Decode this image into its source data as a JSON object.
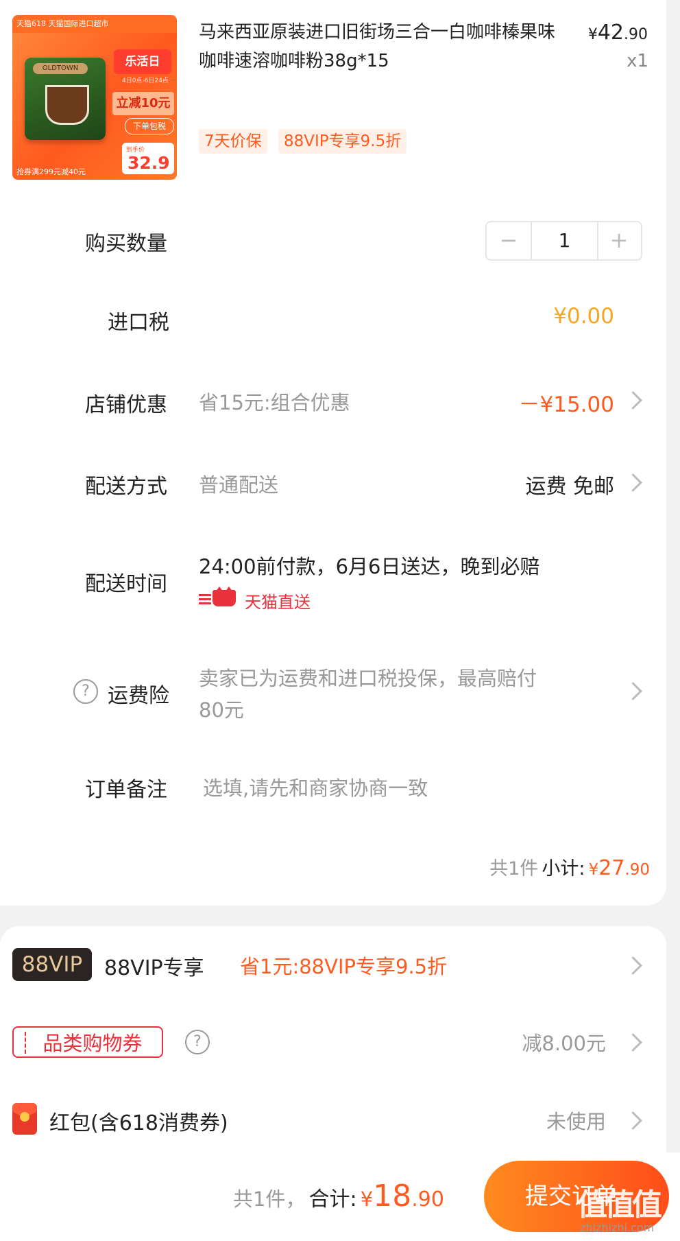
{
  "product": {
    "image": {
      "top_strip": "天猫618 天猫国际进口超市",
      "brand": "OLDTOWN",
      "promo_badge": "乐活日",
      "promo_sub": "4日0点-6日24点",
      "discount": "立减10元",
      "tax_included": "下单包税",
      "final_label": "到手价",
      "final_price": "32.9",
      "bottom_text": "抢券满299元减40元"
    },
    "title": "马来西亚原装进口旧街场三合一白咖啡榛果味咖啡速溶咖啡粉38g*15",
    "price_symbol": "¥",
    "price_int": "42",
    "price_dec": ".90",
    "qty_label": "x1",
    "tags": [
      "7天价保",
      "88VIP专享9.5折"
    ]
  },
  "quantity": {
    "label": "购买数量",
    "minus": "−",
    "value": "1",
    "plus": "+"
  },
  "import_tax": {
    "label": "进口税",
    "value": "¥0.00"
  },
  "shop_discount": {
    "label": "店铺优惠",
    "desc": "省15元:组合优惠",
    "value": "－¥15.00"
  },
  "delivery": {
    "label": "配送方式",
    "desc": "普通配送",
    "value": "运费 免邮"
  },
  "delivery_time": {
    "label": "配送时间",
    "desc": "24:00前付款，6月6日送达，晚到必赔",
    "badge": "天猫直送"
  },
  "shipping_insurance": {
    "label": "运费险",
    "desc_line1": "卖家已为运费和进口税投保，最高赔付",
    "desc_line2": "80元"
  },
  "order_note": {
    "label": "订单备注",
    "placeholder": "选填,请先和商家协商一致"
  },
  "subtotal": {
    "count": "共1件",
    "label": "小计:",
    "symbol": "¥",
    "int": "27",
    "dec": ".90"
  },
  "vip": {
    "badge": "88VIP",
    "label": "88VIP专享",
    "value": "省1元:88VIP专享9.5折"
  },
  "category_coupon": {
    "badge": "品类购物券",
    "value": "减8.00元"
  },
  "red_packet": {
    "label": "红包(含618消费券)",
    "value": "未使用"
  },
  "footer": {
    "count": "共1件，",
    "total_label": "合计:",
    "symbol": "¥",
    "int": "18",
    "dec": ".90",
    "submit": "提交订单",
    "watermark": "值值值",
    "site": "zhizhizhi.com"
  },
  "colors": {
    "accent": "#ff5a1f",
    "tax_yellow": "#f5a623",
    "vip_dark": "#2a2522",
    "coupon_red": "#e8323c"
  }
}
